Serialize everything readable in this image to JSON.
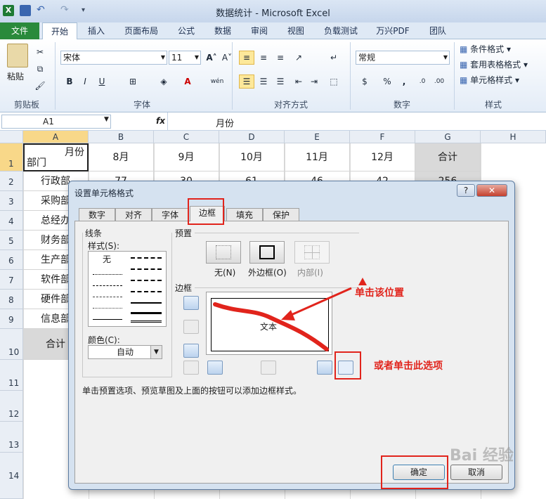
{
  "window": {
    "title": "数据统计 - Microsoft Excel"
  },
  "ribbon": {
    "tabs": [
      "文件",
      "开始",
      "插入",
      "页面布局",
      "公式",
      "数据",
      "审阅",
      "视图",
      "负载测试",
      "万兴PDF",
      "团队"
    ],
    "clipboard": {
      "label": "剪贴板",
      "paste": "粘贴"
    },
    "font": {
      "label": "字体",
      "name": "宋体",
      "size": "11"
    },
    "alignment": {
      "label": "对齐方式"
    },
    "number": {
      "label": "数字",
      "format": "常规"
    },
    "styles": {
      "label": "样式",
      "items": [
        "条件格式",
        "套用表格格式",
        "单元格样式"
      ]
    }
  },
  "formula_bar": {
    "name_box": "A1",
    "fx": "fx",
    "content": "月份"
  },
  "sheet": {
    "columns": [
      "A",
      "B",
      "C",
      "D",
      "E",
      "F",
      "G",
      "H"
    ],
    "rows": [
      "1",
      "2",
      "3",
      "4",
      "5",
      "6",
      "7",
      "8",
      "9",
      "10",
      "11",
      "12",
      "13",
      "14"
    ],
    "header_a1_top": "月份",
    "header_a1_bottom": "部门",
    "header": [
      "8月",
      "9月",
      "10月",
      "11月",
      "12月",
      "合计"
    ],
    "row2_values": [
      "77",
      "30",
      "61",
      "46",
      "42",
      "256"
    ],
    "departments": [
      "行政部",
      "采购部",
      "总经办",
      "财务部",
      "生产部",
      "软件部",
      "硬件部",
      "信息部",
      "合计"
    ]
  },
  "dialog": {
    "title": "设置单元格格式",
    "help": "?",
    "close": "✕",
    "tabs": [
      "数字",
      "对齐",
      "字体",
      "边框",
      "填充",
      "保护"
    ],
    "line_section": "线条",
    "style_label": "样式(S):",
    "none_style": "无",
    "color_label": "颜色(C):",
    "color_value": "自动",
    "preset_section": "预置",
    "presets": [
      "无(N)",
      "外边框(O)",
      "内部(I)"
    ],
    "border_section": "边框",
    "preview_text": "文本",
    "hint": "单击预置选项、预览草图及上面的按钮可以添加边框样式。",
    "ok": "确定",
    "cancel": "取消"
  },
  "annotations": {
    "click_position": "单击该位置",
    "or_click_option": "或者单击此选项"
  },
  "watermark": "Bai 经验",
  "colors": {
    "accent_red": "#e1241c",
    "file_tab": "#2a8a3b",
    "highlight": "#f8d889"
  }
}
